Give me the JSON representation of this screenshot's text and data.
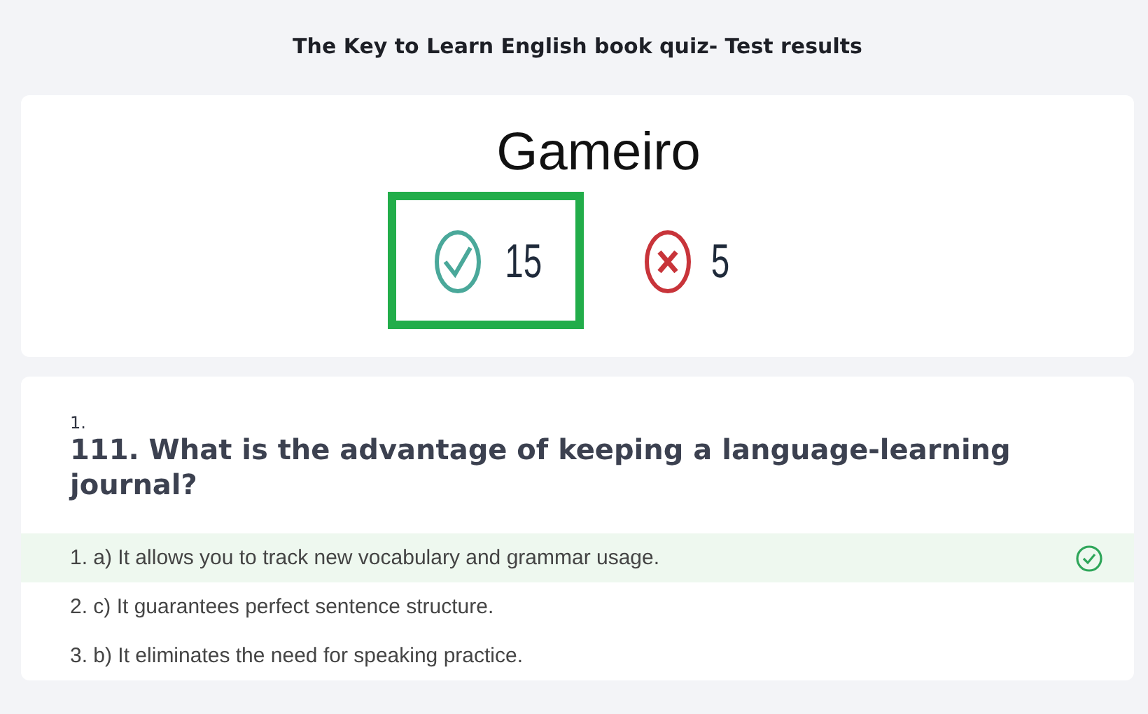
{
  "page_title": "The Key to Learn English book quiz- Test results",
  "result": {
    "name": "Gameiro",
    "scores": [
      {
        "kind": "correct",
        "count": "15",
        "highlighted": true
      },
      {
        "kind": "wrong",
        "count": "5",
        "highlighted": false
      }
    ]
  },
  "question": {
    "number": "1.",
    "text": "111. What is the advantage of keeping a language-learning journal?",
    "answers": [
      {
        "text": "1. a) It allows you to track new vocabulary and grammar usage.",
        "correct": true
      },
      {
        "text": "2. c) It guarantees perfect sentence structure.",
        "correct": false
      },
      {
        "text": "3. b) It eliminates the need for speaking practice.",
        "correct": false
      }
    ]
  }
}
